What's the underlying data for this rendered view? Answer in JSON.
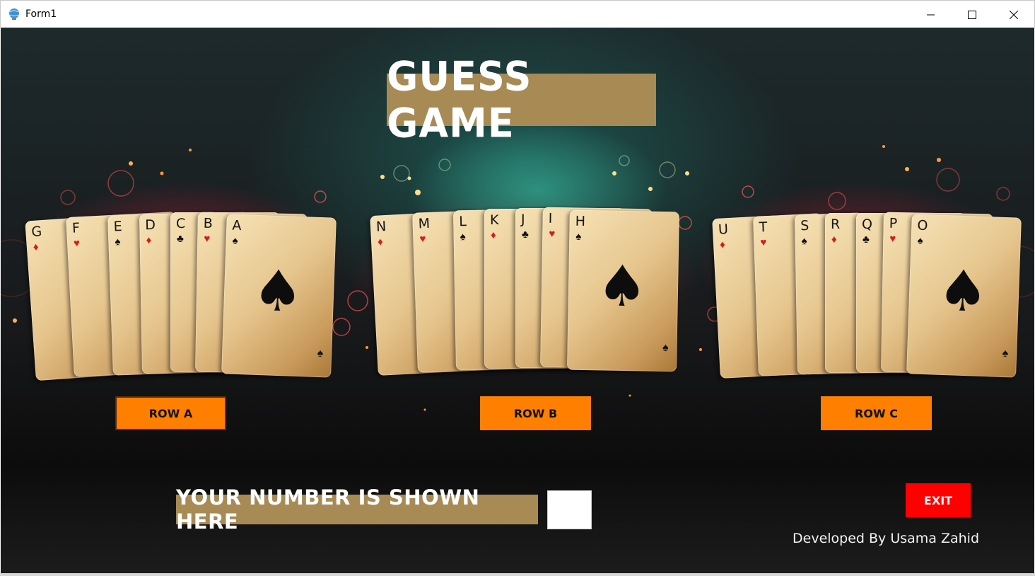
{
  "window": {
    "title": "Form1",
    "icon": "globe-icon",
    "controls": [
      "minimize-icon",
      "maximize-icon",
      "close-icon"
    ]
  },
  "game": {
    "title": "GUESS GAME",
    "rows": [
      {
        "button_label": "ROW A",
        "cards": [
          {
            "rank": "G",
            "suit": "♦",
            "color": "red"
          },
          {
            "rank": "F",
            "suit": "♥",
            "color": "red"
          },
          {
            "rank": "E",
            "suit": "♠",
            "color": "black"
          },
          {
            "rank": "D",
            "suit": "♦",
            "color": "red"
          },
          {
            "rank": "C",
            "suit": "♣",
            "color": "black"
          },
          {
            "rank": "B",
            "suit": "♥",
            "color": "red"
          },
          {
            "rank": "A",
            "suit": "♠",
            "color": "black"
          }
        ]
      },
      {
        "button_label": "ROW B",
        "cards": [
          {
            "rank": "N",
            "suit": "♦",
            "color": "red"
          },
          {
            "rank": "M",
            "suit": "♥",
            "color": "red"
          },
          {
            "rank": "L",
            "suit": "♠",
            "color": "black"
          },
          {
            "rank": "K",
            "suit": "♦",
            "color": "red"
          },
          {
            "rank": "J",
            "suit": "♣",
            "color": "black"
          },
          {
            "rank": "I",
            "suit": "♥",
            "color": "red"
          },
          {
            "rank": "H",
            "suit": "♠",
            "color": "black"
          }
        ]
      },
      {
        "button_label": "ROW C",
        "cards": [
          {
            "rank": "U",
            "suit": "♦",
            "color": "red"
          },
          {
            "rank": "T",
            "suit": "♥",
            "color": "red"
          },
          {
            "rank": "S",
            "suit": "♠",
            "color": "black"
          },
          {
            "rank": "R",
            "suit": "♦",
            "color": "red"
          },
          {
            "rank": "Q",
            "suit": "♣",
            "color": "black"
          },
          {
            "rank": "P",
            "suit": "♥",
            "color": "red"
          },
          {
            "rank": "O",
            "suit": "♠",
            "color": "black"
          }
        ]
      }
    ],
    "result_label": "YOUR NUMBER IS SHOWN HERE",
    "result_value": "",
    "exit_label": "EXIT",
    "credit": "Developed By Usama Zahid"
  },
  "colors": {
    "banner": "#a88a55",
    "row_button": "#ff7f00",
    "exit_button": "#ff0000",
    "suit_red": "#d61a22"
  }
}
